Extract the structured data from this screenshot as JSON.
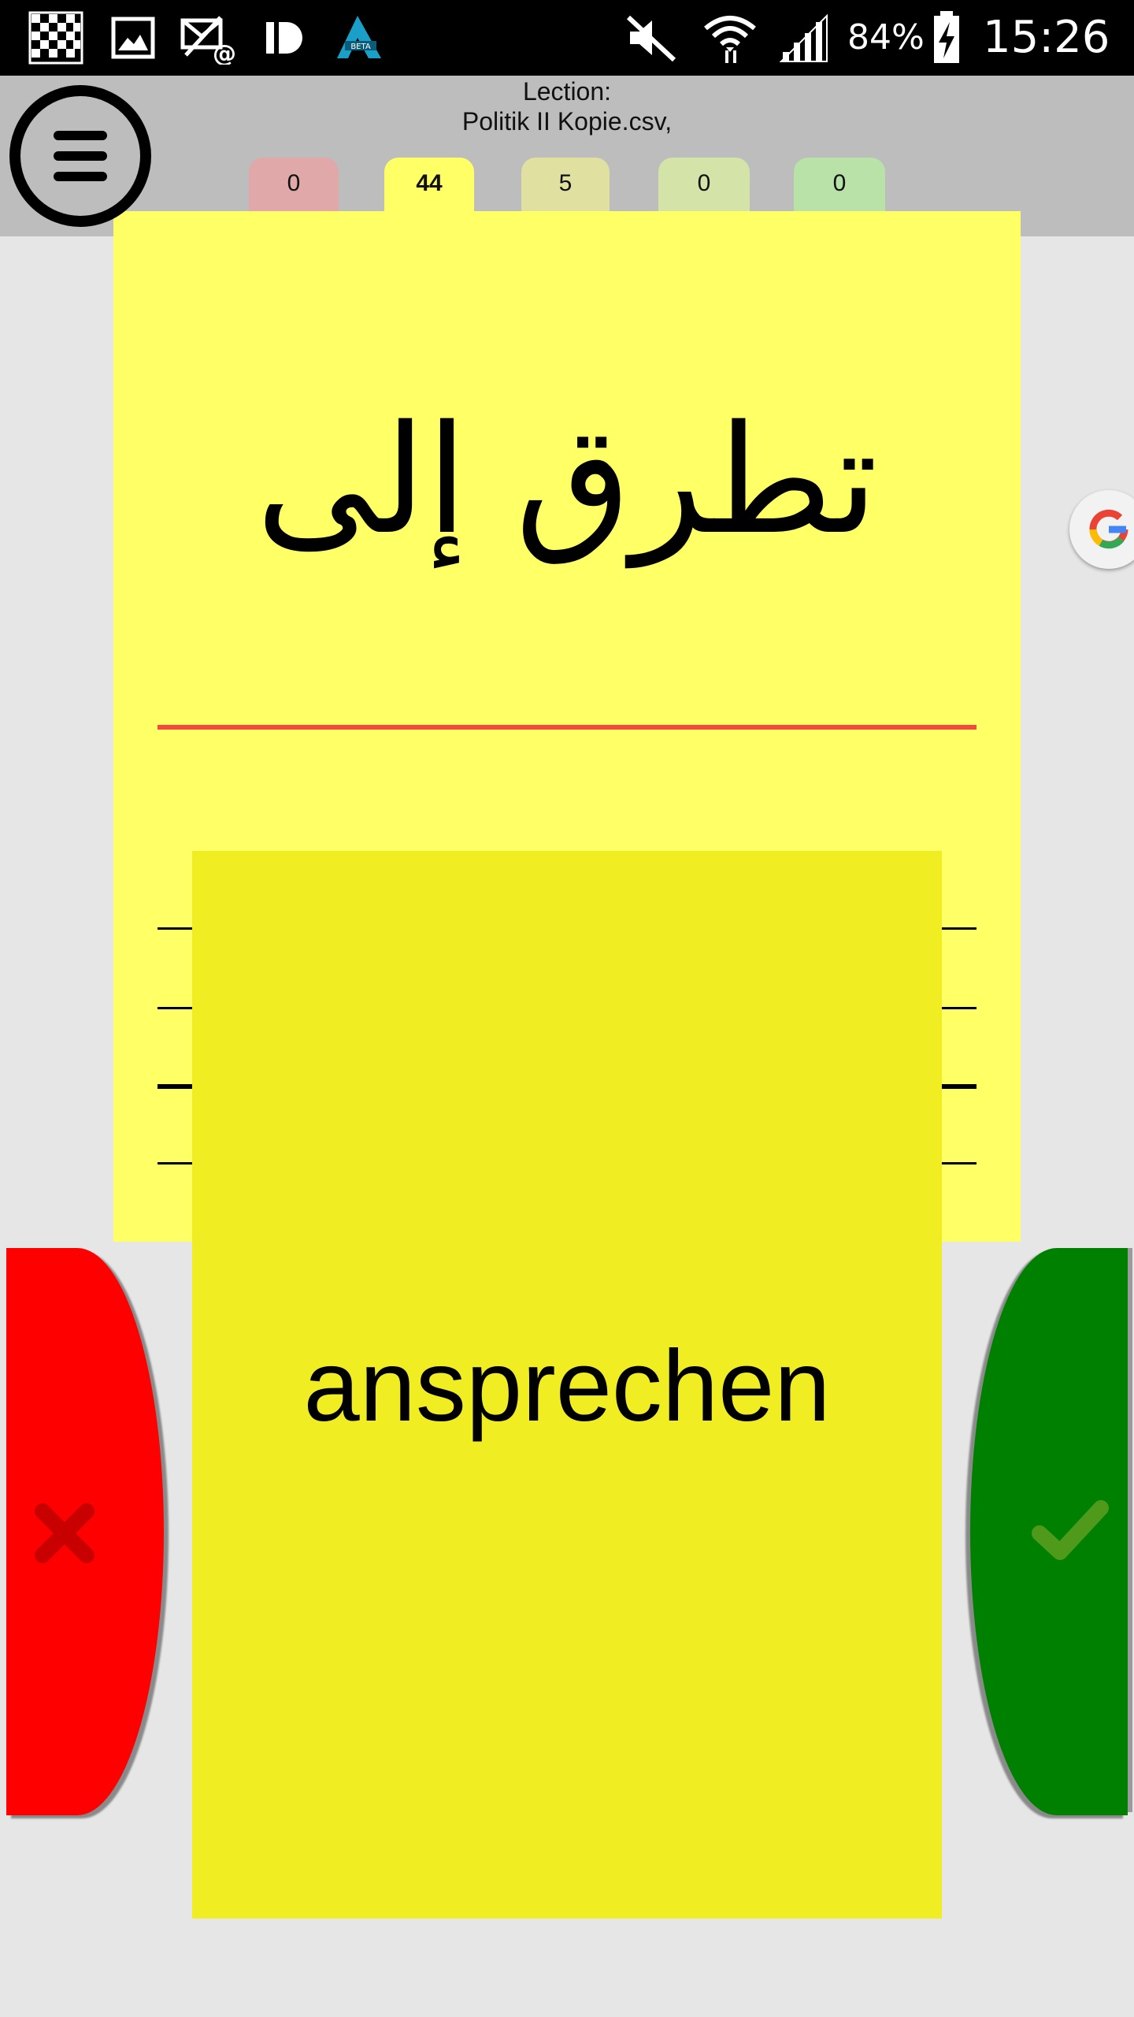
{
  "status_bar": {
    "battery": "84%",
    "time": "15:26",
    "notification_icons": [
      "checkered-app-icon",
      "gallery-icon",
      "email-icon",
      "id-app-icon",
      "beta-app-icon"
    ],
    "system_icons": [
      "mute-icon",
      "wifi-icon",
      "signal-icon",
      "battery-charging-icon"
    ],
    "beta_badge": "BETA"
  },
  "header": {
    "menu_icon": "hamburger-menu-icon",
    "lection_label": "Lection:",
    "lection_file": "Politik II Kopie.csv,",
    "boxes": [
      {
        "count": "0",
        "color": "#e0a8a8",
        "active": false
      },
      {
        "count": "44",
        "color": "#ffff66",
        "active": true
      },
      {
        "count": "5",
        "color": "#e0e0a0",
        "active": false
      },
      {
        "count": "0",
        "color": "#d4e4a8",
        "active": false
      },
      {
        "count": "0",
        "color": "#b8e2a8",
        "active": false
      }
    ]
  },
  "card": {
    "word": "تطرق إلى",
    "divider_color": "#f24a3c",
    "background_color": "#ffff66"
  },
  "translation": {
    "text": "ansprechen",
    "background_color": "#f0ee22"
  },
  "actions": {
    "wrong_icon": "cross-icon",
    "wrong_color": "#ff0000",
    "right_icon": "checkmark-icon",
    "right_color": "#008000"
  },
  "floating": {
    "icon": "google-icon"
  }
}
